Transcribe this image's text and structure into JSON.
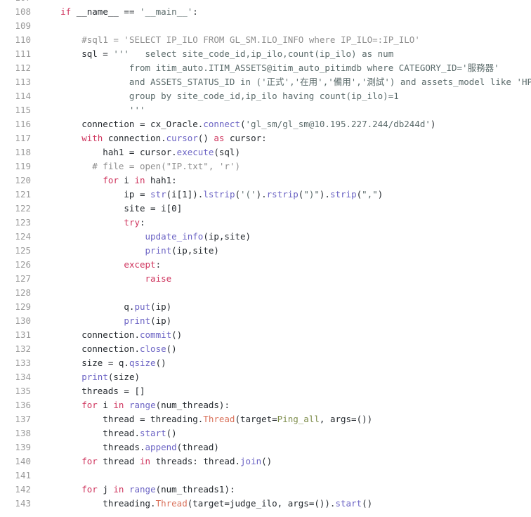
{
  "editor": {
    "language": "python",
    "theme": "light",
    "background_color": "#ffffff",
    "gutter_color": "#9a9a9a",
    "default_text_color": "#24292e",
    "token_colors": {
      "keyword": "#cf355e",
      "function": "#6b63c4",
      "class": "#d9715a",
      "string": "#5a6a6a",
      "comment": "#8f8f8f",
      "plain": "#24292e",
      "parameter": "#7d8c4a"
    },
    "first_visible_line": 107,
    "last_visible_line": 143,
    "line_height_px": 20
  },
  "lines": [
    {
      "n": "107",
      "tokens": []
    },
    {
      "n": "108",
      "tokens": [
        {
          "t": "    ",
          "c": "pl"
        },
        {
          "t": "if",
          "c": "kw"
        },
        {
          "t": " __name__ == ",
          "c": "pl"
        },
        {
          "t": "'__main__'",
          "c": "str"
        },
        {
          "t": ":",
          "c": "pl"
        }
      ]
    },
    {
      "n": "109",
      "tokens": []
    },
    {
      "n": "110",
      "tokens": [
        {
          "t": "        ",
          "c": "pl"
        },
        {
          "t": "#sql1 = 'SELECT IP_ILO FROM GL_SM.ILO_INFO where IP_ILO=:IP_ILO'",
          "c": "com"
        }
      ]
    },
    {
      "n": "111",
      "tokens": [
        {
          "t": "        sql = ",
          "c": "pl"
        },
        {
          "t": "'''   select site_code_id,ip_ilo,count(ip_ilo) as num",
          "c": "str"
        }
      ]
    },
    {
      "n": "112",
      "tokens": [
        {
          "t": "                 from itim_auto.ITIM_ASSETS@itim_auto_pitimdb where CATEGORY_ID='服務器'",
          "c": "str"
        }
      ]
    },
    {
      "n": "113",
      "tokens": [
        {
          "t": "                 and ASSETS_STATUS_ID in ('正式','在用','備用','測試') and assets_model like 'HP%'",
          "c": "str"
        }
      ]
    },
    {
      "n": "114",
      "tokens": [
        {
          "t": "                 group by site_code_id,ip_ilo having count(ip_ilo)=1",
          "c": "str"
        }
      ]
    },
    {
      "n": "115",
      "tokens": [
        {
          "t": "                 '''",
          "c": "str"
        }
      ]
    },
    {
      "n": "116",
      "tokens": [
        {
          "t": "        connection = cx_Oracle.",
          "c": "pl"
        },
        {
          "t": "connect",
          "c": "fn"
        },
        {
          "t": "(",
          "c": "pl"
        },
        {
          "t": "'gl_sm/gl_sm@10.195.227.244/db244d'",
          "c": "str"
        },
        {
          "t": ")",
          "c": "pl"
        }
      ]
    },
    {
      "n": "117",
      "tokens": [
        {
          "t": "        ",
          "c": "pl"
        },
        {
          "t": "with",
          "c": "kw"
        },
        {
          "t": " connection.",
          "c": "pl"
        },
        {
          "t": "cursor",
          "c": "fn"
        },
        {
          "t": "() ",
          "c": "pl"
        },
        {
          "t": "as",
          "c": "kw"
        },
        {
          "t": " cursor:",
          "c": "pl"
        }
      ]
    },
    {
      "n": "118",
      "tokens": [
        {
          "t": "            hah1 = cursor.",
          "c": "pl"
        },
        {
          "t": "execute",
          "c": "fn"
        },
        {
          "t": "(sql)",
          "c": "pl"
        }
      ]
    },
    {
      "n": "119",
      "tokens": [
        {
          "t": "          # file = open(\"IP.txt\", 'r')",
          "c": "com"
        }
      ]
    },
    {
      "n": "120",
      "tokens": [
        {
          "t": "            ",
          "c": "pl"
        },
        {
          "t": "for",
          "c": "kw"
        },
        {
          "t": " i ",
          "c": "pl"
        },
        {
          "t": "in",
          "c": "kw"
        },
        {
          "t": " hah1:",
          "c": "pl"
        }
      ]
    },
    {
      "n": "121",
      "tokens": [
        {
          "t": "                ip = ",
          "c": "pl"
        },
        {
          "t": "str",
          "c": "fn"
        },
        {
          "t": "(i[",
          "c": "pl"
        },
        {
          "t": "1",
          "c": "num"
        },
        {
          "t": "]).",
          "c": "pl"
        },
        {
          "t": "lstrip",
          "c": "fn"
        },
        {
          "t": "(",
          "c": "pl"
        },
        {
          "t": "'('",
          "c": "str"
        },
        {
          "t": ").",
          "c": "pl"
        },
        {
          "t": "rstrip",
          "c": "fn"
        },
        {
          "t": "(",
          "c": "pl"
        },
        {
          "t": "\")\"",
          "c": "str"
        },
        {
          "t": ").",
          "c": "pl"
        },
        {
          "t": "strip",
          "c": "fn"
        },
        {
          "t": "(",
          "c": "pl"
        },
        {
          "t": "\",\"",
          "c": "str"
        },
        {
          "t": ")",
          "c": "pl"
        }
      ]
    },
    {
      "n": "122",
      "tokens": [
        {
          "t": "                site = i[",
          "c": "pl"
        },
        {
          "t": "0",
          "c": "num"
        },
        {
          "t": "]",
          "c": "pl"
        }
      ]
    },
    {
      "n": "123",
      "tokens": [
        {
          "t": "                ",
          "c": "pl"
        },
        {
          "t": "try",
          "c": "kw"
        },
        {
          "t": ":",
          "c": "pl"
        }
      ]
    },
    {
      "n": "124",
      "tokens": [
        {
          "t": "                    ",
          "c": "pl"
        },
        {
          "t": "update_info",
          "c": "fn"
        },
        {
          "t": "(ip,site)",
          "c": "pl"
        }
      ]
    },
    {
      "n": "125",
      "tokens": [
        {
          "t": "                    ",
          "c": "pl"
        },
        {
          "t": "print",
          "c": "fn"
        },
        {
          "t": "(ip,site)",
          "c": "pl"
        }
      ]
    },
    {
      "n": "126",
      "tokens": [
        {
          "t": "                ",
          "c": "pl"
        },
        {
          "t": "except",
          "c": "kw"
        },
        {
          "t": ":",
          "c": "pl"
        }
      ]
    },
    {
      "n": "127",
      "tokens": [
        {
          "t": "                    ",
          "c": "pl"
        },
        {
          "t": "raise",
          "c": "kw"
        }
      ]
    },
    {
      "n": "128",
      "tokens": []
    },
    {
      "n": "129",
      "tokens": [
        {
          "t": "                q.",
          "c": "pl"
        },
        {
          "t": "put",
          "c": "fn"
        },
        {
          "t": "(ip)",
          "c": "pl"
        }
      ]
    },
    {
      "n": "130",
      "tokens": [
        {
          "t": "                ",
          "c": "pl"
        },
        {
          "t": "print",
          "c": "fn"
        },
        {
          "t": "(ip)",
          "c": "pl"
        }
      ]
    },
    {
      "n": "131",
      "tokens": [
        {
          "t": "        connection.",
          "c": "pl"
        },
        {
          "t": "commit",
          "c": "fn"
        },
        {
          "t": "()",
          "c": "pl"
        }
      ]
    },
    {
      "n": "132",
      "tokens": [
        {
          "t": "        connection.",
          "c": "pl"
        },
        {
          "t": "close",
          "c": "fn"
        },
        {
          "t": "()",
          "c": "pl"
        }
      ]
    },
    {
      "n": "133",
      "tokens": [
        {
          "t": "        size = q.",
          "c": "pl"
        },
        {
          "t": "qsize",
          "c": "fn"
        },
        {
          "t": "()",
          "c": "pl"
        }
      ]
    },
    {
      "n": "134",
      "tokens": [
        {
          "t": "        ",
          "c": "pl"
        },
        {
          "t": "print",
          "c": "fn"
        },
        {
          "t": "(size)",
          "c": "pl"
        }
      ]
    },
    {
      "n": "135",
      "tokens": [
        {
          "t": "        threads = []",
          "c": "pl"
        }
      ]
    },
    {
      "n": "136",
      "tokens": [
        {
          "t": "        ",
          "c": "pl"
        },
        {
          "t": "for",
          "c": "kw"
        },
        {
          "t": " i ",
          "c": "pl"
        },
        {
          "t": "in",
          "c": "kw"
        },
        {
          "t": " ",
          "c": "pl"
        },
        {
          "t": "range",
          "c": "fn"
        },
        {
          "t": "(num_threads):",
          "c": "pl"
        }
      ]
    },
    {
      "n": "137",
      "tokens": [
        {
          "t": "            thread = threading.",
          "c": "pl"
        },
        {
          "t": "Thread",
          "c": "cls"
        },
        {
          "t": "(target=",
          "c": "pl"
        },
        {
          "t": "Ping_all",
          "c": "self"
        },
        {
          "t": ", args=())",
          "c": "pl"
        }
      ]
    },
    {
      "n": "138",
      "tokens": [
        {
          "t": "            thread.",
          "c": "pl"
        },
        {
          "t": "start",
          "c": "fn"
        },
        {
          "t": "()",
          "c": "pl"
        }
      ]
    },
    {
      "n": "139",
      "tokens": [
        {
          "t": "            threads.",
          "c": "pl"
        },
        {
          "t": "append",
          "c": "fn"
        },
        {
          "t": "(thread)",
          "c": "pl"
        }
      ]
    },
    {
      "n": "140",
      "tokens": [
        {
          "t": "        ",
          "c": "pl"
        },
        {
          "t": "for",
          "c": "kw"
        },
        {
          "t": " thread ",
          "c": "pl"
        },
        {
          "t": "in",
          "c": "kw"
        },
        {
          "t": " threads: thread.",
          "c": "pl"
        },
        {
          "t": "join",
          "c": "fn"
        },
        {
          "t": "()",
          "c": "pl"
        }
      ]
    },
    {
      "n": "141",
      "tokens": []
    },
    {
      "n": "142",
      "tokens": [
        {
          "t": "        ",
          "c": "pl"
        },
        {
          "t": "for",
          "c": "kw"
        },
        {
          "t": " j ",
          "c": "pl"
        },
        {
          "t": "in",
          "c": "kw"
        },
        {
          "t": " ",
          "c": "pl"
        },
        {
          "t": "range",
          "c": "fn"
        },
        {
          "t": "(num_threads1):",
          "c": "pl"
        }
      ]
    },
    {
      "n": "143",
      "tokens": [
        {
          "t": "            threading.",
          "c": "pl"
        },
        {
          "t": "Thread",
          "c": "cls"
        },
        {
          "t": "(target=judge_ilo, args=()).",
          "c": "pl"
        },
        {
          "t": "start",
          "c": "fn"
        },
        {
          "t": "()",
          "c": "pl"
        }
      ]
    }
  ]
}
